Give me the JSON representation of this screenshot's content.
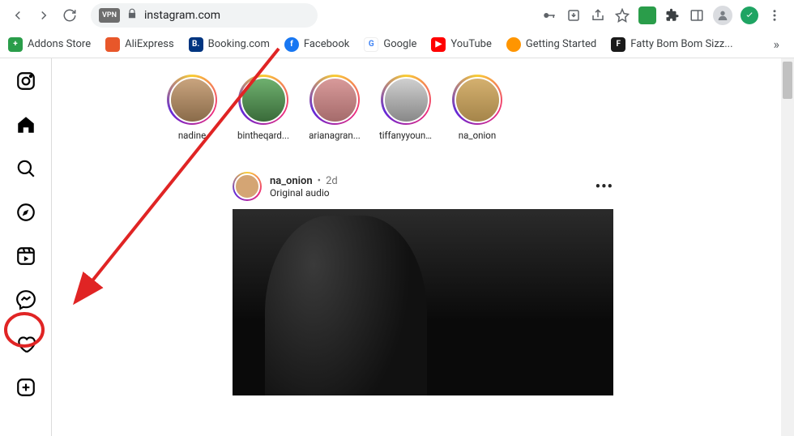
{
  "chrome": {
    "url": "instagram.com",
    "vpn_badge": "VPN",
    "bookmarks": [
      {
        "label": "Addons Store",
        "bg": "#2a9d4a",
        "initial": "+"
      },
      {
        "label": "AliExpress",
        "bg": "#e8572a",
        "initial": ""
      },
      {
        "label": "Booking.com",
        "bg": "#003580",
        "initial": "B."
      },
      {
        "label": "Facebook",
        "bg": "#1877f2",
        "initial": "f"
      },
      {
        "label": "Google",
        "bg": "#ffffff",
        "initial": "G"
      },
      {
        "label": "YouTube",
        "bg": "#ff0000",
        "initial": "▶"
      },
      {
        "label": "Getting Started",
        "bg": "#ff9500",
        "initial": ""
      },
      {
        "label": "Fatty Bom Bom Sizz...",
        "bg": "#1a1a1a",
        "initial": "F"
      }
    ],
    "more_bookmarks_glyph": "»"
  },
  "instagram": {
    "stories": [
      {
        "name": "nadine"
      },
      {
        "name": "bintheqard..."
      },
      {
        "name": "arianagran..."
      },
      {
        "name": "tiffanyyoun..."
      },
      {
        "name": "na_onion"
      }
    ],
    "post": {
      "user": "na_onion",
      "time": "2d",
      "audio_label": "Original audio",
      "dot": "•",
      "more_glyph": "•••"
    }
  },
  "annotation": {
    "color": "#e02424"
  }
}
